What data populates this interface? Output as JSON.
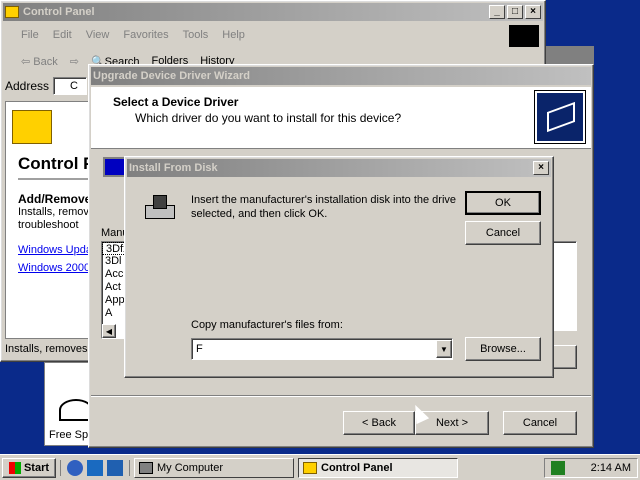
{
  "control_panel": {
    "title": "Control Panel",
    "menu": [
      "File",
      "Edit",
      "View",
      "Favorites",
      "Tools",
      "Help"
    ],
    "toolbar": {
      "back": "Back",
      "search": "Search",
      "folders": "Folders",
      "history": "History"
    },
    "address_label": "Address",
    "address_value": "C",
    "panel_heading": "Control P",
    "section_title": "Add/Remove",
    "section_desc_1": "Installs, remov",
    "section_desc_2": "troubleshoot",
    "link_1": "Windows Upda",
    "link_2": "Windows 2000",
    "status_text": "Installs, removes",
    "free_space": "Free Sp"
  },
  "wizard": {
    "title": "Upgrade Device Driver Wizard",
    "heading": "Select a Device Driver",
    "subheading": "Which driver do you want to install for this device?",
    "list_label": "Manu",
    "list_items": [
      "3Dfx",
      "3Dl",
      "Acc",
      "Act",
      "App",
      "A"
    ],
    "back_button": "< Back",
    "next_button": "Next >",
    "cancel_button": "Cancel"
  },
  "install_dialog": {
    "title": "Install From Disk",
    "message": "Insert the manufacturer's installation disk into the drive selected, and then click OK.",
    "ok_button": "OK",
    "cancel_button": "Cancel",
    "copy_label": "Copy manufacturer's files from:",
    "path_value": "F",
    "browse_button": "Browse..."
  },
  "taskbar": {
    "start_label": "Start",
    "tasks": [
      {
        "label": "My Computer",
        "active": false
      },
      {
        "label": "Control Panel",
        "active": true
      }
    ],
    "clock": "2:14 AM"
  },
  "colors": {
    "desktop": "#0a2a8a",
    "title_active": "#0a246a",
    "face": "#d4d0c8"
  }
}
